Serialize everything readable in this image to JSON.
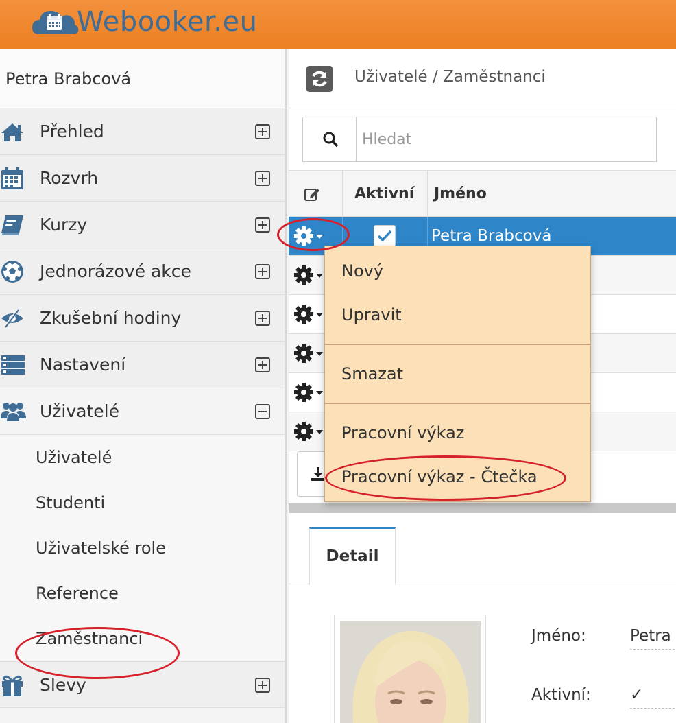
{
  "app": {
    "name": "Webooker.eu",
    "brand_color": "#ec7f22",
    "logo_color": "#3f6d96"
  },
  "sidebar": {
    "user_name": "Petra Brabcová",
    "items": [
      {
        "label": "Přehled",
        "icon": "home-icon",
        "expanded": false
      },
      {
        "label": "Rozvrh",
        "icon": "calendar-icon",
        "expanded": false
      },
      {
        "label": "Kurzy",
        "icon": "book-icon",
        "expanded": false
      },
      {
        "label": "Jednorázové akce",
        "icon": "soccer-ball-icon",
        "expanded": false
      },
      {
        "label": "Zkušební hodiny",
        "icon": "eye-slash-icon",
        "expanded": false
      },
      {
        "label": "Nastavení",
        "icon": "list-icon",
        "expanded": false
      },
      {
        "label": "Uživatelé",
        "icon": "users-icon",
        "expanded": true
      },
      {
        "label": "Slevy",
        "icon": "gift-icon",
        "expanded": false
      }
    ],
    "submenu": [
      "Uživatelé",
      "Studenti",
      "Uživatelské role",
      "Reference",
      "Zaměstnanci"
    ]
  },
  "main": {
    "breadcrumb": "Uživatelé / Zaměstnanci",
    "search": {
      "placeholder": "Hledat",
      "value": ""
    },
    "grid": {
      "columns": [
        "Aktivní",
        "Jméno"
      ],
      "selected_row": {
        "active": true,
        "name": "Petra Brabcová"
      },
      "row_count": 6
    },
    "detail": {
      "tab": "Detail",
      "fields": [
        {
          "label": "Jméno:",
          "value": "Petra"
        },
        {
          "label": "Aktivní:",
          "value": "✓"
        }
      ]
    }
  },
  "dropdown": {
    "items": [
      "Nový",
      "Upravit",
      "Smazat",
      "Pracovní výkaz",
      "Pracovní výkaz - Čtečka"
    ],
    "bg_color": "#fce0b8"
  },
  "colors": {
    "selection": "#2e86c9",
    "highlight_circle": "#d6202a"
  }
}
